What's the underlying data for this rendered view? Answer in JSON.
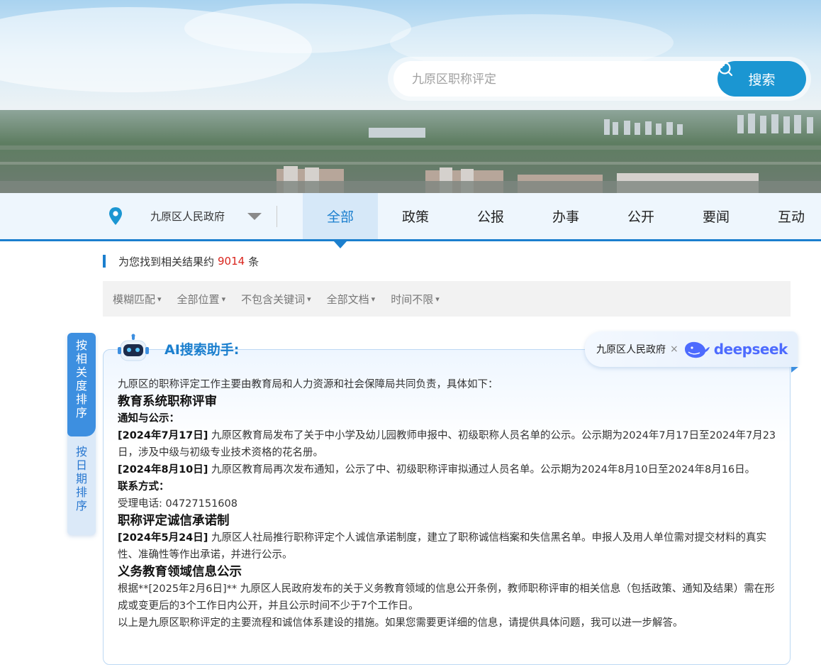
{
  "search": {
    "placeholder": "九原区职称评定",
    "button_label": "搜索"
  },
  "nav": {
    "location_label": "九原区人民政府",
    "tabs": [
      {
        "label": "全部",
        "active": true
      },
      {
        "label": "政策",
        "active": false
      },
      {
        "label": "公报",
        "active": false
      },
      {
        "label": "办事",
        "active": false
      },
      {
        "label": "公开",
        "active": false
      },
      {
        "label": "要闻",
        "active": false
      },
      {
        "label": "互动",
        "active": false
      }
    ]
  },
  "results": {
    "prefix": "为您找到相关结果约",
    "count": "9014",
    "suffix": "条"
  },
  "filters": [
    "模糊匹配",
    "全部位置",
    "不包含关键词",
    "全部文档",
    "时间不限"
  ],
  "sort": {
    "by_relevance": [
      "按",
      "相",
      "关",
      "度",
      "排",
      "序"
    ],
    "by_date": [
      "按",
      "日",
      "期",
      "排",
      "序"
    ]
  },
  "ai": {
    "title": "AI搜索助手:",
    "badge_org": "九原区人民政府",
    "badge_x": "×",
    "badge_brand": "deepseek",
    "intro": "九原区的职称评定工作主要由教育局和人力资源和社会保障局共同负责，具体如下：",
    "section1_title": "教育系统职称评审",
    "section1_sub1": "通知与公示：",
    "item1_date": "[2024年7月17日]",
    "item1_text": " 九原区教育局发布了关于中小学及幼儿园教师申报中、初级职称人员名单的公示。公示期为2024年7月17日至2024年7月23日，涉及中级与初级专业技术资格的花名册。",
    "item2_date": "[2024年8月10日]",
    "item2_text": " 九原区教育局再次发布通知，公示了中、初级职称评审拟通过人员名单。公示期为2024年8月10日至2024年8月16日。",
    "section1_sub2": "联系方式：",
    "contact": "受理电话: 04727151608",
    "section2_title": "职称评定诚信承诺制",
    "item3_date": "[2024年5月24日]",
    "item3_text": " 九原区人社局推行职称评定个人诚信承诺制度，建立了职称诚信档案和失信黑名单。申报人及用人单位需对提交材料的真实性、准确性等作出承诺，并进行公示。",
    "section3_title": "义务教育领域信息公示",
    "para3": "根据**[2025年2月6日]** 九原区人民政府发布的关于义务教育领域的信息公开条例，教师职称评审的相关信息（包括政策、通知及结果）需在形成或变更后的3个工作日内公开，并且公示时间不少于7个工作日。",
    "closing": "以上是九原区职称评定的主要流程和诚信体系建设的措施。如果您需要更详细的信息，请提供具体问题，我可以进一步解答。"
  },
  "colors": {
    "accent": "#1b7fce",
    "search_button": "#1b96d2",
    "count_red": "#d9251d",
    "deepseek_blue": "#4d6bfe"
  }
}
